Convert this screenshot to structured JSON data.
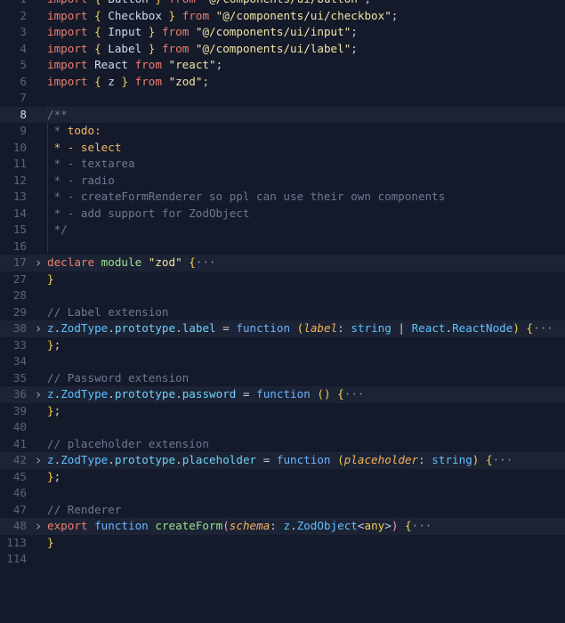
{
  "editor": {
    "lines": [
      {
        "n": "2",
        "fold": false,
        "hl": false,
        "tokens": [
          [
            "kw",
            "import"
          ],
          [
            "op",
            " "
          ],
          [
            "br",
            "{"
          ],
          [
            "id",
            " Checkbox "
          ],
          [
            "br",
            "}"
          ],
          [
            "op",
            " "
          ],
          [
            "kw",
            "from"
          ],
          [
            "op",
            " "
          ],
          [
            "str",
            "\"@/components/ui/checkbox\""
          ],
          [
            "op",
            ";"
          ]
        ]
      },
      {
        "n": "3",
        "fold": false,
        "hl": false,
        "tokens": [
          [
            "kw",
            "import"
          ],
          [
            "op",
            " "
          ],
          [
            "br",
            "{"
          ],
          [
            "id",
            " Input "
          ],
          [
            "br",
            "}"
          ],
          [
            "op",
            " "
          ],
          [
            "kw",
            "from"
          ],
          [
            "op",
            " "
          ],
          [
            "str",
            "\"@/components/ui/input\""
          ],
          [
            "op",
            ";"
          ]
        ]
      },
      {
        "n": "4",
        "fold": false,
        "hl": false,
        "tokens": [
          [
            "kw",
            "import"
          ],
          [
            "op",
            " "
          ],
          [
            "br",
            "{"
          ],
          [
            "id",
            " Label "
          ],
          [
            "br",
            "}"
          ],
          [
            "op",
            " "
          ],
          [
            "kw",
            "from"
          ],
          [
            "op",
            " "
          ],
          [
            "str",
            "\"@/components/ui/label\""
          ],
          [
            "op",
            ";"
          ]
        ]
      },
      {
        "n": "5",
        "fold": false,
        "hl": false,
        "tokens": [
          [
            "kw",
            "import"
          ],
          [
            "id",
            " React "
          ],
          [
            "kw",
            "from"
          ],
          [
            "op",
            " "
          ],
          [
            "str",
            "\"react\""
          ],
          [
            "op",
            ";"
          ]
        ]
      },
      {
        "n": "6",
        "fold": false,
        "hl": false,
        "tokens": [
          [
            "kw",
            "import"
          ],
          [
            "op",
            " "
          ],
          [
            "br",
            "{"
          ],
          [
            "id",
            " z "
          ],
          [
            "br",
            "}"
          ],
          [
            "op",
            " "
          ],
          [
            "kw",
            "from"
          ],
          [
            "op",
            " "
          ],
          [
            "str",
            "\"zod\""
          ],
          [
            "op",
            ";"
          ]
        ]
      },
      {
        "n": "7",
        "fold": false,
        "hl": false,
        "tokens": []
      },
      {
        "n": "8",
        "fold": false,
        "hl": true,
        "active": true,
        "tokens": [
          [
            "cm",
            "/**"
          ]
        ]
      },
      {
        "n": "9",
        "fold": false,
        "hl": false,
        "tokens": [
          [
            "cm",
            " * "
          ],
          [
            "todo",
            "todo:"
          ]
        ]
      },
      {
        "n": "10",
        "fold": false,
        "hl": false,
        "tokens": [
          [
            "todo",
            " * - select"
          ]
        ]
      },
      {
        "n": "11",
        "fold": false,
        "hl": false,
        "tokens": [
          [
            "cm",
            " * - textarea"
          ]
        ]
      },
      {
        "n": "12",
        "fold": false,
        "hl": false,
        "tokens": [
          [
            "cm",
            " * - radio"
          ]
        ]
      },
      {
        "n": "13",
        "fold": false,
        "hl": false,
        "tokens": [
          [
            "cm",
            " * - createFormRenderer so ppl can use their own components"
          ]
        ]
      },
      {
        "n": "14",
        "fold": false,
        "hl": false,
        "tokens": [
          [
            "cm",
            " * - add support for ZodObject"
          ]
        ]
      },
      {
        "n": "15",
        "fold": false,
        "hl": false,
        "tokens": [
          [
            "cm",
            " */"
          ]
        ]
      },
      {
        "n": "16",
        "fold": false,
        "hl": false,
        "tokens": []
      },
      {
        "n": "17",
        "fold": true,
        "hl": true,
        "tokens": [
          [
            "kw",
            "declare"
          ],
          [
            "op",
            " "
          ],
          [
            "fn",
            "module"
          ],
          [
            "op",
            " "
          ],
          [
            "str",
            "\"zod\""
          ],
          [
            "op",
            " "
          ],
          [
            "br",
            "{"
          ],
          [
            "ell",
            "···"
          ]
        ]
      },
      {
        "n": "27",
        "fold": false,
        "hl": false,
        "tokens": [
          [
            "br",
            "}"
          ]
        ]
      },
      {
        "n": "28",
        "fold": false,
        "hl": false,
        "tokens": []
      },
      {
        "n": "29",
        "fold": false,
        "hl": false,
        "tokens": [
          [
            "cm",
            "// Label extension"
          ]
        ]
      },
      {
        "n": "30",
        "fold": true,
        "hl": true,
        "tokens": [
          [
            "type",
            "z"
          ],
          [
            "op",
            "."
          ],
          [
            "type",
            "ZodType"
          ],
          [
            "op",
            "."
          ],
          [
            "prop",
            "prototype"
          ],
          [
            "op",
            "."
          ],
          [
            "prop",
            "label"
          ],
          [
            "op",
            " = "
          ],
          [
            "kw2",
            "function"
          ],
          [
            "op",
            " "
          ],
          [
            "br",
            "("
          ],
          [
            "param",
            "label"
          ],
          [
            "op",
            ": "
          ],
          [
            "type",
            "string"
          ],
          [
            "op",
            " | "
          ],
          [
            "type",
            "React"
          ],
          [
            "op",
            "."
          ],
          [
            "type",
            "ReactNode"
          ],
          [
            "br",
            ")"
          ],
          [
            "op",
            " "
          ],
          [
            "br",
            "{"
          ],
          [
            "ell",
            "···"
          ]
        ]
      },
      {
        "n": "33",
        "fold": false,
        "hl": false,
        "tokens": [
          [
            "br",
            "}"
          ],
          [
            "op",
            ";"
          ]
        ]
      },
      {
        "n": "34",
        "fold": false,
        "hl": false,
        "tokens": []
      },
      {
        "n": "35",
        "fold": false,
        "hl": false,
        "tokens": [
          [
            "cm",
            "// Password extension"
          ]
        ]
      },
      {
        "n": "36",
        "fold": true,
        "hl": true,
        "tokens": [
          [
            "type",
            "z"
          ],
          [
            "op",
            "."
          ],
          [
            "type",
            "ZodType"
          ],
          [
            "op",
            "."
          ],
          [
            "prop",
            "prototype"
          ],
          [
            "op",
            "."
          ],
          [
            "prop",
            "password"
          ],
          [
            "op",
            " = "
          ],
          [
            "kw2",
            "function"
          ],
          [
            "op",
            " "
          ],
          [
            "br",
            "()"
          ],
          [
            "op",
            " "
          ],
          [
            "br",
            "{"
          ],
          [
            "ell",
            "···"
          ]
        ]
      },
      {
        "n": "39",
        "fold": false,
        "hl": false,
        "tokens": [
          [
            "br",
            "}"
          ],
          [
            "op",
            ";"
          ]
        ]
      },
      {
        "n": "40",
        "fold": false,
        "hl": false,
        "tokens": []
      },
      {
        "n": "41",
        "fold": false,
        "hl": false,
        "tokens": [
          [
            "cm",
            "// placeholder extension"
          ]
        ]
      },
      {
        "n": "42",
        "fold": true,
        "hl": true,
        "tokens": [
          [
            "type",
            "z"
          ],
          [
            "op",
            "."
          ],
          [
            "type",
            "ZodType"
          ],
          [
            "op",
            "."
          ],
          [
            "prop",
            "prototype"
          ],
          [
            "op",
            "."
          ],
          [
            "prop",
            "placeholder"
          ],
          [
            "op",
            " = "
          ],
          [
            "kw2",
            "function"
          ],
          [
            "op",
            " "
          ],
          [
            "br",
            "("
          ],
          [
            "param",
            "placeholder"
          ],
          [
            "op",
            ": "
          ],
          [
            "type",
            "string"
          ],
          [
            "br",
            ")"
          ],
          [
            "op",
            " "
          ],
          [
            "br",
            "{"
          ],
          [
            "ell",
            "···"
          ]
        ]
      },
      {
        "n": "45",
        "fold": false,
        "hl": false,
        "tokens": [
          [
            "br",
            "}"
          ],
          [
            "op",
            ";"
          ]
        ]
      },
      {
        "n": "46",
        "fold": false,
        "hl": false,
        "tokens": []
      },
      {
        "n": "47",
        "fold": false,
        "hl": false,
        "tokens": [
          [
            "cm",
            "// Renderer"
          ]
        ]
      },
      {
        "n": "48",
        "fold": true,
        "hl": true,
        "tokens": [
          [
            "kw",
            "export"
          ],
          [
            "op",
            " "
          ],
          [
            "kw2",
            "function"
          ],
          [
            "op",
            " "
          ],
          [
            "fn",
            "createForm"
          ],
          [
            "brp",
            "("
          ],
          [
            "param",
            "schema"
          ],
          [
            "op",
            ": "
          ],
          [
            "type",
            "z"
          ],
          [
            "op",
            "."
          ],
          [
            "type",
            "ZodObject"
          ],
          [
            "op",
            "<"
          ],
          [
            "br",
            "any"
          ],
          [
            "op",
            ">"
          ],
          [
            "brp",
            ")"
          ],
          [
            "op",
            " "
          ],
          [
            "br",
            "{"
          ],
          [
            "ell",
            "···"
          ]
        ]
      },
      {
        "n": "113",
        "fold": false,
        "hl": false,
        "tokens": [
          [
            "br",
            "}"
          ]
        ]
      },
      {
        "n": "114",
        "fold": false,
        "hl": false,
        "tokens": []
      }
    ],
    "partial_top_line": {
      "n": "1",
      "tokens": [
        [
          "kw",
          "import"
        ],
        [
          "op",
          " "
        ],
        [
          "br",
          "{"
        ],
        [
          "id",
          " Button "
        ],
        [
          "br",
          "}"
        ],
        [
          "op",
          " "
        ],
        [
          "kw",
          "from"
        ],
        [
          "op",
          " "
        ],
        [
          "str",
          "\"@/components/ui/button\""
        ],
        [
          "op",
          ";"
        ]
      ]
    },
    "fold_icon": "chevron-right-icon",
    "colors": {
      "background": "#141a2a",
      "line_highlight": "#1b2335",
      "keyword": "#f07f6d",
      "string": "#f3e3a6",
      "comment": "#6e7891",
      "function": "#9be38c",
      "type": "#5fc1ff"
    }
  }
}
